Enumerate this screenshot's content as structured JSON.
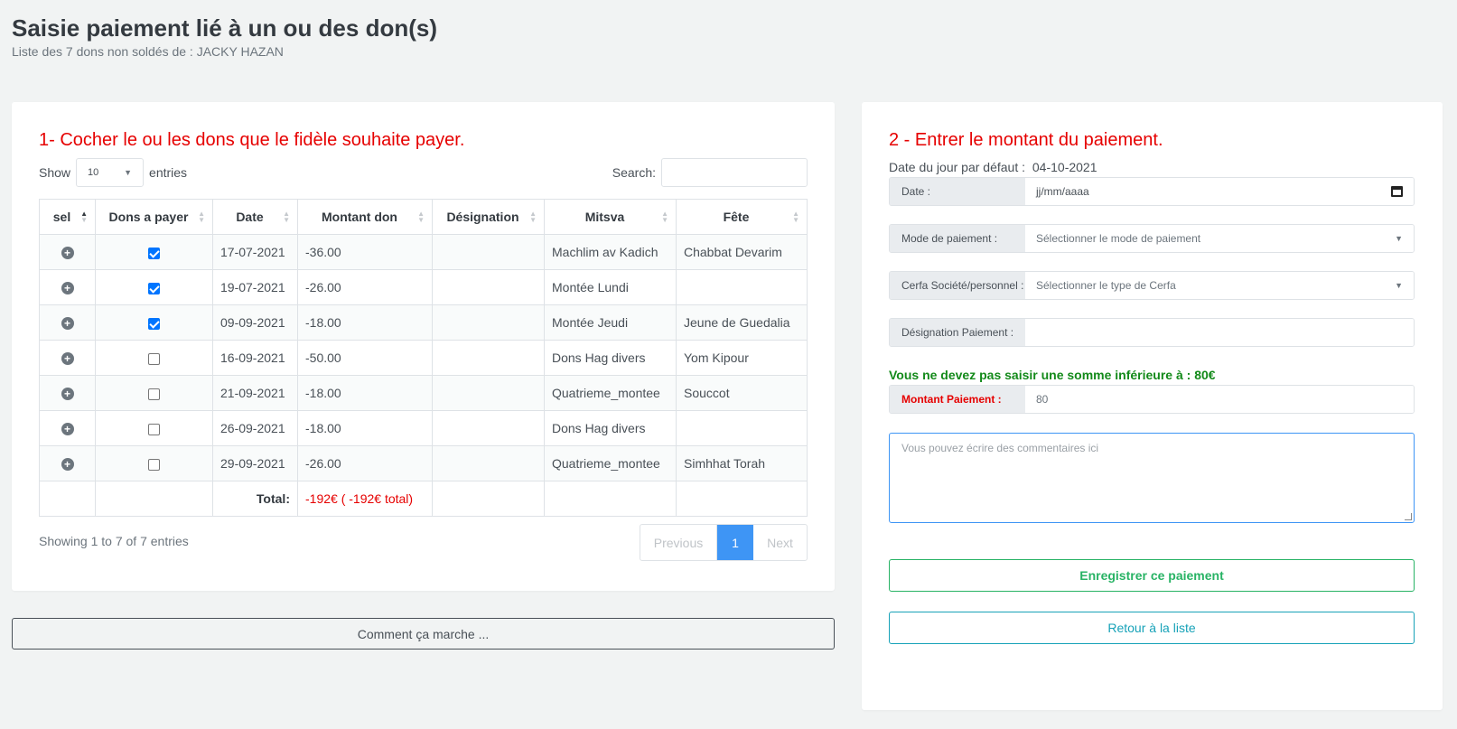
{
  "page": {
    "title": "Saisie paiement lié à un ou des don(s)",
    "subtitle": "Liste des 7 dons non soldés de : JACKY HAZAN"
  },
  "left": {
    "section_title": "1- Cocher le ou les dons que le fidèle souhaite payer.",
    "show_label": "Show",
    "entries_value": "10",
    "entries_label": "entries",
    "search_label": "Search:",
    "columns": [
      "sel",
      "Dons a payer",
      "Date",
      "Montant don",
      "Désignation",
      "Mitsva",
      "Fête"
    ],
    "rows": [
      {
        "checked": true,
        "date": "17-07-2021",
        "montant": "-36.00",
        "designation": "",
        "mitsva": "Machlim av Kadich",
        "fete": "Chabbat Devarim"
      },
      {
        "checked": true,
        "date": "19-07-2021",
        "montant": "-26.00",
        "designation": "",
        "mitsva": "Montée Lundi",
        "fete": ""
      },
      {
        "checked": true,
        "date": "09-09-2021",
        "montant": "-18.00",
        "designation": "",
        "mitsva": "Montée Jeudi",
        "fete": "Jeune de Guedalia"
      },
      {
        "checked": false,
        "date": "16-09-2021",
        "montant": "-50.00",
        "designation": "",
        "mitsva": "Dons Hag divers",
        "fete": "Yom Kipour"
      },
      {
        "checked": false,
        "date": "21-09-2021",
        "montant": "-18.00",
        "designation": "",
        "mitsva": "Quatrieme_montee",
        "fete": "Souccot"
      },
      {
        "checked": false,
        "date": "26-09-2021",
        "montant": "-18.00",
        "designation": "",
        "mitsva": "Dons Hag divers",
        "fete": ""
      },
      {
        "checked": false,
        "date": "29-09-2021",
        "montant": "-26.00",
        "designation": "",
        "mitsva": "Quatrieme_montee",
        "fete": "Simhhat Torah"
      }
    ],
    "total_label": "Total:",
    "total_value": "-192€ ( -192€ total)",
    "info": "Showing 1 to 7 of 7 entries",
    "pagination": {
      "previous": "Previous",
      "current": "1",
      "next": "Next"
    }
  },
  "help_button": "Comment ça marche ...",
  "right": {
    "section_title": "2 - Entrer le montant du paiement.",
    "default_date_label": "Date du jour par défaut :",
    "default_date_value": "04-10-2021",
    "date_label": "Date :",
    "date_placeholder": "jj/mm/aaaa",
    "mode_label": "Mode de paiement :",
    "mode_value": "Sélectionner le mode de paiement",
    "cerfa_label": "Cerfa Société/personnel :",
    "cerfa_value": "Sélectionner le type de Cerfa",
    "designation_label": "Désignation Paiement :",
    "designation_value": "",
    "warning": "Vous ne devez pas saisir une somme inférieure à : 80€",
    "montant_label": "Montant Paiement :",
    "montant_value": "80",
    "comments_placeholder": "Vous pouvez écrire des commentaires ici",
    "save_button": "Enregistrer ce paiement",
    "back_button": "Retour à la liste"
  }
}
